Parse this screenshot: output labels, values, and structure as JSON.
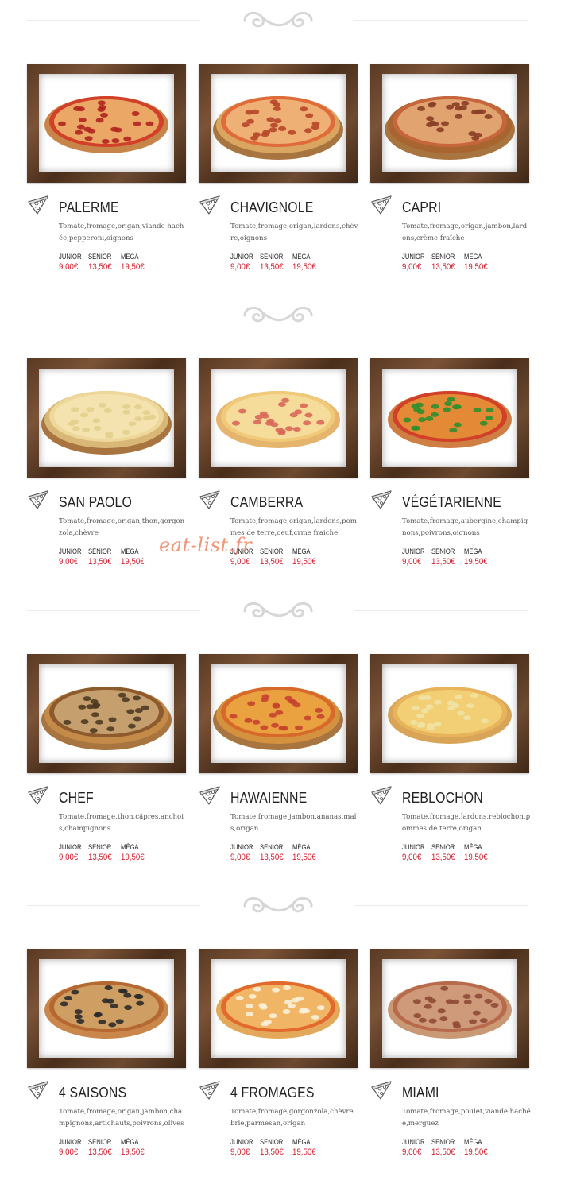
{
  "colors": {
    "price": "#d21c2c",
    "frame": "#5a3a24",
    "divider": "#ececec",
    "watermark": "#ee8260"
  },
  "watermark": "eat-list.fr",
  "icons": {
    "divider": "swirl-ornament-icon",
    "item": "pizza-slice-icon"
  },
  "menu": [
    {
      "name": "PALERME",
      "description": "Tomate,fromage,origan,viande hachée,pepperoni,oignons",
      "prices": [
        {
          "size": "JUNIOR",
          "price": "9,00€"
        },
        {
          "size": "SENIOR",
          "price": "13,50€"
        },
        {
          "size": "MÉGA",
          "price": "19,50€"
        }
      ]
    },
    {
      "name": "CHAVIGNOLE",
      "description": "Tomate,fromage,origan,lardons,chèvre,oignons",
      "prices": [
        {
          "size": "JUNIOR",
          "price": "9,00€"
        },
        {
          "size": "SENIOR",
          "price": "13,50€"
        },
        {
          "size": "MÉGA",
          "price": "19,50€"
        }
      ]
    },
    {
      "name": "CAPRI",
      "description": "Tomate,fromage,origan,jambon,lardons,crème fraîche",
      "prices": [
        {
          "size": "JUNIOR",
          "price": "9,00€"
        },
        {
          "size": "SENIOR",
          "price": "13,50€"
        },
        {
          "size": "MÉGA",
          "price": "19,50€"
        }
      ]
    },
    {
      "name": "SAN PAOLO",
      "description": "Tomate,fromage,origan,thon,gorgonzola,chèvre",
      "prices": [
        {
          "size": "JUNIOR",
          "price": "9,00€"
        },
        {
          "size": "SENIOR",
          "price": "13,50€"
        },
        {
          "size": "MÉGA",
          "price": "19,50€"
        }
      ]
    },
    {
      "name": "CAMBERRA",
      "description": "Tomate,fromage,origan,lardons,pommes de terre,oeuf,crme fraiche",
      "prices": [
        {
          "size": "JUNIOR",
          "price": "9,00€"
        },
        {
          "size": "SENIOR",
          "price": "13,50€"
        },
        {
          "size": "MÉGA",
          "price": "19,50€"
        }
      ]
    },
    {
      "name": "VÉGÉTARIENNE",
      "description": "Tomate,fromage,aubergine,champignons,poivrons,oignons",
      "prices": [
        {
          "size": "JUNIOR",
          "price": "9,00€"
        },
        {
          "size": "SENIOR",
          "price": "13,50€"
        },
        {
          "size": "MÉGA",
          "price": "19,50€"
        }
      ]
    },
    {
      "name": "CHEF",
      "description": "Tomate,fromage,thon,câpres,anchois,champignons",
      "prices": [
        {
          "size": "JUNIOR",
          "price": "9,00€"
        },
        {
          "size": "SENIOR",
          "price": "13,50€"
        },
        {
          "size": "MÉGA",
          "price": "19,50€"
        }
      ]
    },
    {
      "name": "HAWAIENNE",
      "description": "Tomate,fromage,jambon,ananas,maïs,origan",
      "prices": [
        {
          "size": "JUNIOR",
          "price": "9,00€"
        },
        {
          "size": "SENIOR",
          "price": "13,50€"
        },
        {
          "size": "MÉGA",
          "price": "19,50€"
        }
      ]
    },
    {
      "name": "REBLOCHON",
      "description": "Tomate,fromage,lardons,reblochon,pommes de terre,origan",
      "prices": [
        {
          "size": "JUNIOR",
          "price": "9,00€"
        },
        {
          "size": "SENIOR",
          "price": "13,50€"
        },
        {
          "size": "MÉGA",
          "price": "19,50€"
        }
      ]
    },
    {
      "name": "4 SAISONS",
      "description": "Tomate,fromage,origan,jambon,champignons,artichauts,poivrons,olives",
      "prices": [
        {
          "size": "JUNIOR",
          "price": "9,00€"
        },
        {
          "size": "SENIOR",
          "price": "13,50€"
        },
        {
          "size": "MÉGA",
          "price": "19,50€"
        }
      ]
    },
    {
      "name": "4 FROMAGES",
      "description": "Tomate,fromage,gorgonzola,chèvre,brie,parmesan,origan",
      "prices": [
        {
          "size": "JUNIOR",
          "price": "9,00€"
        },
        {
          "size": "SENIOR",
          "price": "13,50€"
        },
        {
          "size": "MÉGA",
          "price": "19,50€"
        }
      ]
    },
    {
      "name": "MIAMI",
      "description": "Tomate,fromage,poulet,viande hachée,merguez",
      "prices": [
        {
          "size": "JUNIOR",
          "price": "9,00€"
        },
        {
          "size": "SENIOR",
          "price": "13,50€"
        },
        {
          "size": "MÉGA",
          "price": "19,50€"
        }
      ]
    }
  ]
}
